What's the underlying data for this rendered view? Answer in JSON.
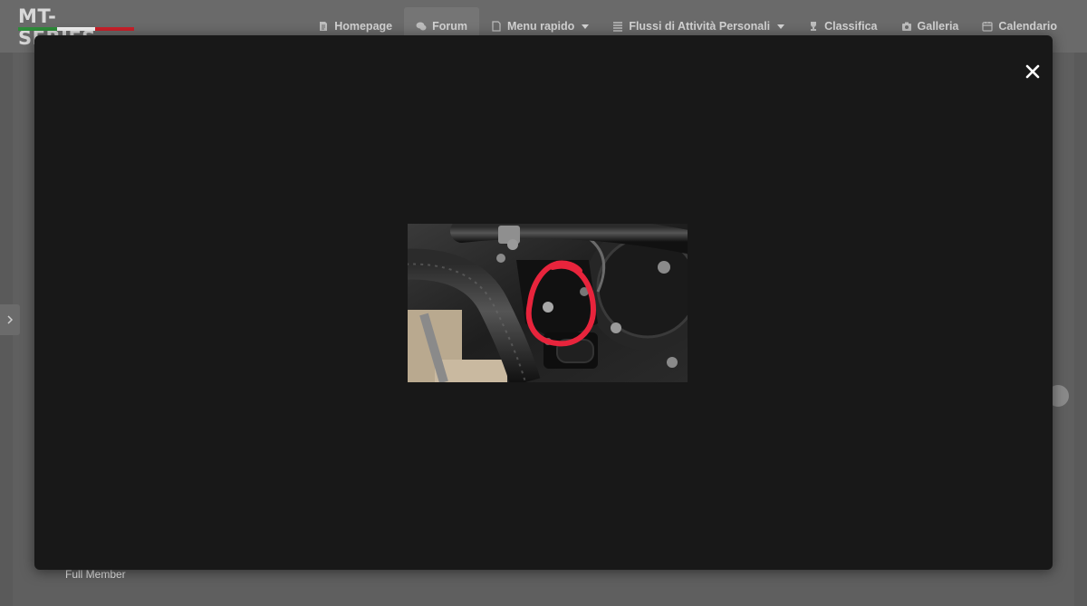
{
  "site": {
    "logo_text": "MT-SERIES",
    "flag_colors": [
      "#2e8b3a",
      "#f2f2f2",
      "#c8202a"
    ]
  },
  "nav": {
    "items": [
      {
        "label": "Homepage",
        "icon": "page-icon",
        "has_dropdown": false,
        "active": false
      },
      {
        "label": "Forum",
        "icon": "chat-icon",
        "has_dropdown": false,
        "active": true
      },
      {
        "label": "Menu rapido",
        "icon": "document-icon",
        "has_dropdown": true,
        "active": false
      },
      {
        "label": "Flussi di Attività Personali",
        "icon": "list-icon",
        "has_dropdown": true,
        "active": false
      },
      {
        "label": "Classifica",
        "icon": "trophy-icon",
        "has_dropdown": false,
        "active": false
      },
      {
        "label": "Galleria",
        "icon": "camera-icon",
        "has_dropdown": false,
        "active": false
      },
      {
        "label": "Calendario",
        "icon": "calendar-icon",
        "has_dropdown": false,
        "active": false
      }
    ]
  },
  "post": {
    "author_rank": "Full Member"
  },
  "lightbox": {
    "close_icon": "close-icon",
    "image_subject": "motorcycle-engine-photo",
    "highlight_color": "#e8243c"
  },
  "colors": {
    "modal_bg": "#181818",
    "overlay_bg": "#5a5a5a",
    "nav_text": "#d2d2d2"
  }
}
